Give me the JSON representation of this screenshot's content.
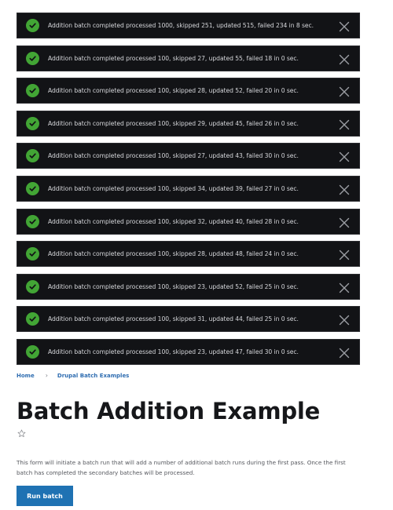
{
  "messages": [
    {
      "icon": "check-circle-icon",
      "text": "Addition batch completed processed 1000, skipped 251, updated 515, failed 234 in 8 sec.",
      "processed": 1000,
      "skipped": 251,
      "updated": 515,
      "failed": 234,
      "seconds": 8
    },
    {
      "icon": "check-circle-icon",
      "text": "Addition batch completed processed 100, skipped 27, updated 55, failed 18 in 0 sec.",
      "processed": 100,
      "skipped": 27,
      "updated": 55,
      "failed": 18,
      "seconds": 0
    },
    {
      "icon": "check-circle-icon",
      "text": "Addition batch completed processed 100, skipped 28, updated 52, failed 20 in 0 sec.",
      "processed": 100,
      "skipped": 28,
      "updated": 52,
      "failed": 20,
      "seconds": 0
    },
    {
      "icon": "check-circle-icon",
      "text": "Addition batch completed processed 100, skipped 29, updated 45, failed 26 in 0 sec.",
      "processed": 100,
      "skipped": 29,
      "updated": 45,
      "failed": 26,
      "seconds": 0
    },
    {
      "icon": "check-circle-icon",
      "text": "Addition batch completed processed 100, skipped 27, updated 43, failed 30 in 0 sec.",
      "processed": 100,
      "skipped": 27,
      "updated": 43,
      "failed": 30,
      "seconds": 0
    },
    {
      "icon": "check-circle-icon",
      "text": "Addition batch completed processed 100, skipped 34, updated 39, failed 27 in 0 sec.",
      "processed": 100,
      "skipped": 34,
      "updated": 39,
      "failed": 27,
      "seconds": 0
    },
    {
      "icon": "check-circle-icon",
      "text": "Addition batch completed processed 100, skipped 32, updated 40, failed 28 in 0 sec.",
      "processed": 100,
      "skipped": 32,
      "updated": 40,
      "failed": 28,
      "seconds": 0
    },
    {
      "icon": "check-circle-icon",
      "text": "Addition batch completed processed 100, skipped 28, updated 48, failed 24 in 0 sec.",
      "processed": 100,
      "skipped": 28,
      "updated": 48,
      "failed": 24,
      "seconds": 0
    },
    {
      "icon": "check-circle-icon",
      "text": "Addition batch completed processed 100, skipped 23, updated 52, failed 25 in 0 sec.",
      "processed": 100,
      "skipped": 23,
      "updated": 52,
      "failed": 25,
      "seconds": 0
    },
    {
      "icon": "check-circle-icon",
      "text": "Addition batch completed processed 100, skipped 31, updated 44, failed 25 in 0 sec.",
      "processed": 100,
      "skipped": 31,
      "updated": 44,
      "failed": 25,
      "seconds": 0
    },
    {
      "icon": "check-circle-icon",
      "text": "Addition batch completed processed 100, skipped 23, updated 47, failed 30 in 0 sec.",
      "processed": 100,
      "skipped": 23,
      "updated": 47,
      "failed": 30,
      "seconds": 0
    }
  ],
  "messages_close_icon": "close-icon",
  "breadcrumb": {
    "items": [
      {
        "label": "Home"
      },
      {
        "label": "Drupal Batch Examples"
      }
    ],
    "separator": "›"
  },
  "page": {
    "title": "Batch Addition Example",
    "favorite_icon": "star-outline-icon",
    "description": "This form will initiate a batch run that will add a number of additional batch runs during the first pass. Once the first batch has completed the secondary batches will be processed."
  },
  "form": {
    "submit_label": "Run batch"
  },
  "colors": {
    "message_bg": "#121316",
    "success_icon": "#42a535",
    "link": "#2f6db1",
    "primary_button": "#1f72b3"
  }
}
